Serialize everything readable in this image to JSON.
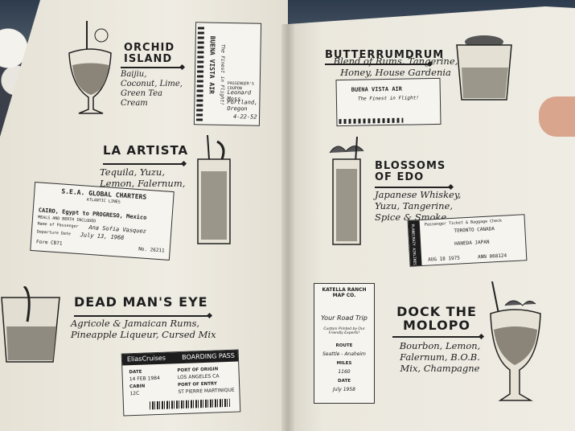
{
  "left_page": {
    "orchid": {
      "title": "ORCHID ISLAND",
      "desc": "Baijiu, Coconut, Lime, Green Tea Cream"
    },
    "la_artista": {
      "title": "LA ARTISTA",
      "desc": "Tequila, Yuzu, Lemon, Falernum, Rosa Blend"
    },
    "dead_man": {
      "title": "DEAD MAN'S EYE",
      "desc": "Agricole & Jamaican Rums, Pineapple Liqueur, Cursed Mix"
    }
  },
  "right_page": {
    "butter": {
      "title": "BUTTERRUMDRUM",
      "desc": "Blend of Rums, Tangerine, Honey, House Gardenia Mix"
    },
    "blossoms": {
      "title": "BLOSSOMS OF EDO",
      "desc": "Japanese Whiskey, Yuzu, Tangerine, Spice & Smoke"
    },
    "dock": {
      "title": "DOCK THE MOLOPO",
      "desc": "Bourbon, Lemon, Falernum, B.O.B. Mix, Champagne"
    }
  },
  "tickets": {
    "bva_coupon": {
      "airline": "BUENA VISTA AIR",
      "tag": "The Finest in Flight!",
      "header": "PASSENGER'S COUPON",
      "name": "Leonard Moss",
      "city": "Portland, Oregon",
      "date": "4-22-52"
    },
    "sea": {
      "line1": "S.E.A. GLOBAL CHARTERS",
      "line2": "ATLANTIC LINES",
      "route": "CAIRO, Egypt to PROGRESO, Mexico",
      "note": "MEALS AND BERTH INCLUDED",
      "passenger_label": "Name of Passenger",
      "passenger": "Ana Sofia Vasquez",
      "date_label": "Departure Date",
      "date": "July 13, 1968",
      "form": "Form CB71",
      "no": "No. 26211"
    },
    "boarding": {
      "brand": "EliasCruises",
      "header": "BOARDING PASS",
      "date_label": "DATE",
      "date": "14 FEB 1984",
      "origin_label": "PORT OF ORIGIN",
      "origin": "LOS ANGELES CA",
      "cabin_label": "CABIN",
      "cabin": "12C",
      "entry_label": "PORT OF ENTRY",
      "entry": "ST PIERRE MARTINIQUE"
    },
    "bva_small": {
      "airline": "BUENA VISTA AIR",
      "tag": "The Finest in Flight!"
    },
    "planecrazy": {
      "brand": "PLANECRAZY AIRLINES",
      "header": "Passenger Ticket & Baggage Check",
      "dep": "TORONTO CANADA",
      "arr": "HANEDA JAPAN",
      "date": "AUG 18 1975",
      "no": "ANN 068124"
    },
    "katella": {
      "header": "KATELLA RANCH MAP CO.",
      "title": "Your Road Trip",
      "sub": "Custom Printed by Our Friendly Experts!",
      "route_label": "ROUTE",
      "route": "Seattle - Anaheim",
      "miles_label": "MILES",
      "miles": "1160",
      "date_label": "DATE",
      "date": "July 1958"
    }
  }
}
